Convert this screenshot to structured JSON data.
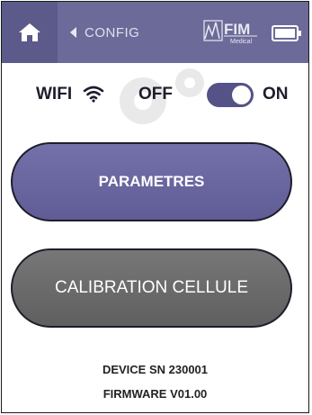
{
  "topbar": {
    "back_label": "CONFIG",
    "logo_text": "FIM",
    "logo_subtext": "Medical"
  },
  "wifi": {
    "label": "WIFI",
    "off_label": "OFF",
    "on_label": "ON",
    "state": "ON"
  },
  "buttons": {
    "parametres": "PARAMETRES",
    "calibration": "CALIBRATION CELLULE"
  },
  "footer": {
    "device_sn": "DEVICE SN 230001",
    "firmware": "FIRMWARE V01.00"
  },
  "colors": {
    "topbar": "#6c6a98",
    "toggle": "#545286",
    "primary_button": "#6a67a0",
    "secondary_button": "#6a6a6a"
  }
}
